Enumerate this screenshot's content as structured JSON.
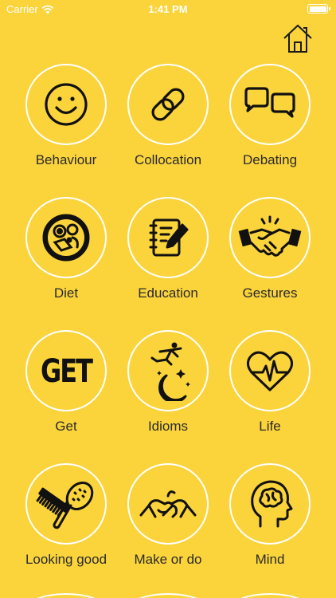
{
  "status_bar": {
    "carrier": "Carrier",
    "time": "1:41 PM",
    "battery_level": 1.0
  },
  "header": {
    "home_icon": "home-icon"
  },
  "topics": [
    {
      "label": "Behaviour",
      "icon": "smiley-face-icon"
    },
    {
      "label": "Collocation",
      "icon": "chain-link-icon"
    },
    {
      "label": "Debating",
      "icon": "speech-bubbles-icon"
    },
    {
      "label": "Diet",
      "icon": "food-bowl-icon"
    },
    {
      "label": "Education",
      "icon": "notebook-pencil-icon"
    },
    {
      "label": "Gestures",
      "icon": "handshake-icon"
    },
    {
      "label": "Get",
      "icon_text": "GET"
    },
    {
      "label": "Idioms",
      "icon": "jumping-over-moon-icon"
    },
    {
      "label": "Life",
      "icon": "heartbeat-icon"
    },
    {
      "label": "Looking good",
      "icon": "comb-brush-icon"
    },
    {
      "label": "Make or do",
      "icon": "pinky-promise-icon"
    },
    {
      "label": "Mind",
      "icon": "head-brain-icon"
    }
  ],
  "colors": {
    "background": "#FBD43C",
    "circle_border": "#FFFFFF",
    "icon": "#111111"
  }
}
